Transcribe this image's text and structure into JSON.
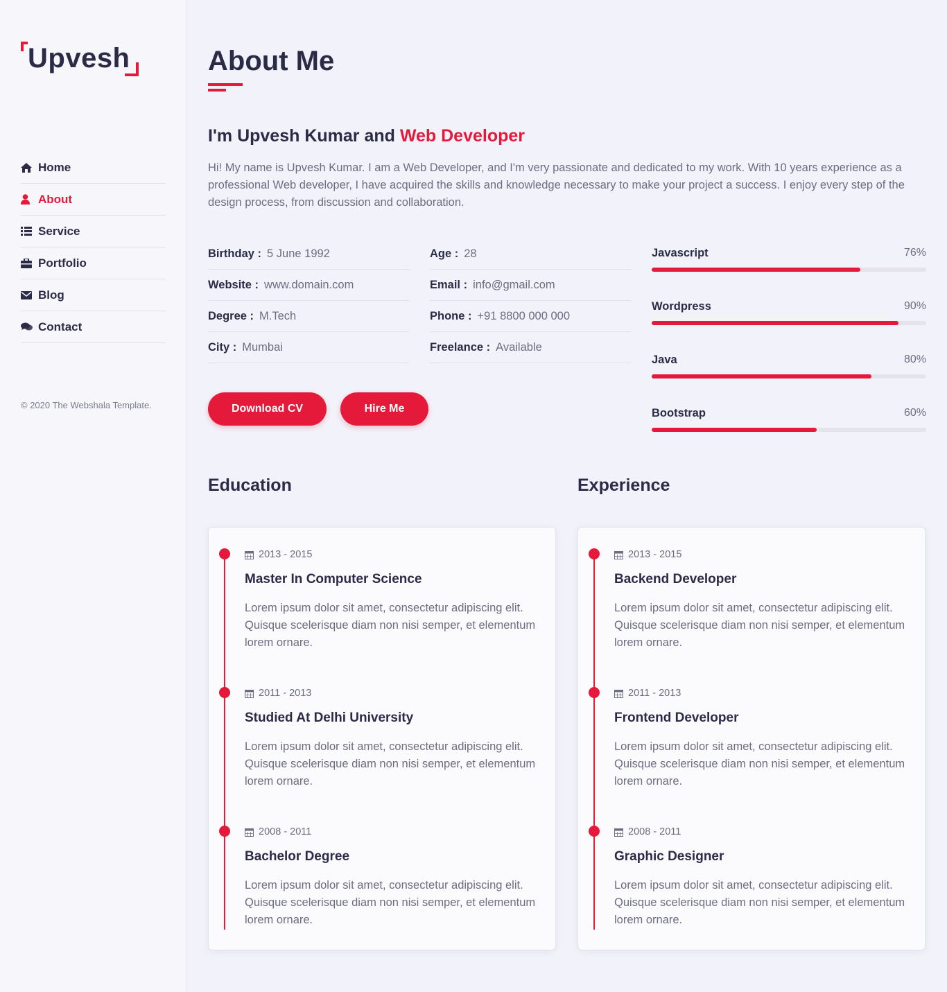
{
  "brand": {
    "logo_text": "Upvesh"
  },
  "nav": [
    {
      "label": "Home",
      "icon": "home-icon"
    },
    {
      "label": "About",
      "icon": "user-icon",
      "active": true
    },
    {
      "label": "Service",
      "icon": "list-icon"
    },
    {
      "label": "Portfolio",
      "icon": "briefcase-icon"
    },
    {
      "label": "Blog",
      "icon": "envelope-icon"
    },
    {
      "label": "Contact",
      "icon": "comments-icon"
    }
  ],
  "copyright": "© 2020 The Webshala Template.",
  "about": {
    "title": "About Me",
    "heading_prefix": "I'm Upvesh Kumar and ",
    "heading_accent": "Web Developer",
    "intro": "Hi! My name is Upvesh Kumar. I am a Web Developer, and I'm very passionate and dedicated to my work. With 10 years experience as a professional Web developer, I have acquired the skills and knowledge necessary to make your project a success. I enjoy every step of the design process, from discussion and collaboration."
  },
  "info_left": [
    {
      "label": "Birthday :",
      "value": "5 June 1992"
    },
    {
      "label": "Website :",
      "value": "www.domain.com"
    },
    {
      "label": "Degree :",
      "value": "M.Tech"
    },
    {
      "label": "City :",
      "value": "Mumbai"
    }
  ],
  "info_right": [
    {
      "label": "Age :",
      "value": "28"
    },
    {
      "label": "Email :",
      "value": "info@gmail.com"
    },
    {
      "label": "Phone :",
      "value": "+91 8800 000 000"
    },
    {
      "label": "Freelance :",
      "value": "Available"
    }
  ],
  "buttons": {
    "download": "Download CV",
    "hire": "Hire Me"
  },
  "skills": [
    {
      "name": "Javascript",
      "percent_label": "76%",
      "value": 0.76
    },
    {
      "name": "Wordpress",
      "percent_label": "90%",
      "value": 0.9
    },
    {
      "name": "Java",
      "percent_label": "80%",
      "value": 0.8
    },
    {
      "name": "Bootstrap",
      "percent_label": "60%",
      "value": 0.6
    }
  ],
  "education": {
    "title": "Education",
    "items": [
      {
        "date": "2013 - 2015",
        "title": "Master In Computer Science",
        "desc": "Lorem ipsum dolor sit amet, consectetur adipiscing elit. Quisque scelerisque diam non nisi semper, et elementum lorem ornare."
      },
      {
        "date": "2011 - 2013",
        "title": "Studied At Delhi University",
        "desc": "Lorem ipsum dolor sit amet, consectetur adipiscing elit. Quisque scelerisque diam non nisi semper, et elementum lorem ornare."
      },
      {
        "date": "2008 - 2011",
        "title": "Bachelor Degree",
        "desc": "Lorem ipsum dolor sit amet, consectetur adipiscing elit. Quisque scelerisque diam non nisi semper, et elementum lorem ornare."
      }
    ]
  },
  "experience": {
    "title": "Experience",
    "items": [
      {
        "date": "2013 - 2015",
        "title": "Backend Developer",
        "desc": "Lorem ipsum dolor sit amet, consectetur adipiscing elit. Quisque scelerisque diam non nisi semper, et elementum lorem ornare."
      },
      {
        "date": "2011 - 2013",
        "title": "Frontend Developer",
        "desc": "Lorem ipsum dolor sit amet, consectetur adipiscing elit. Quisque scelerisque diam non nisi semper, et elementum lorem ornare."
      },
      {
        "date": "2008 - 2011",
        "title": "Graphic Designer",
        "desc": "Lorem ipsum dolor sit amet, consectetur adipiscing elit. Quisque scelerisque diam non nisi semper, et elementum lorem ornare."
      }
    ]
  },
  "colors": {
    "accent": "#e5193a",
    "heading": "#2b2b47",
    "text": "#6b6d80"
  }
}
